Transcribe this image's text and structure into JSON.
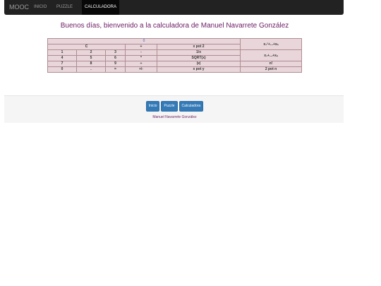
{
  "nav": {
    "brand": "MOOC",
    "links": [
      "INICIO",
      "PUZZLE",
      "CALCULADORA"
    ]
  },
  "greeting": "Buenos días, bienvenido a la calculadora de Manuel Navarrete González",
  "calculator": {
    "display": "0",
    "clear": "C",
    "keys": {
      "plus": "+",
      "minus": "-",
      "times": "*",
      "div": "÷",
      "sign": "+/-",
      "dot": ".",
      "equals": "=",
      "d0": "0",
      "d1": "1",
      "d2": "2",
      "d3": "3",
      "d4": "4",
      "d5": "5",
      "d6": "6",
      "d7": "7",
      "d8": "8",
      "d9": "9"
    },
    "funcs": {
      "xpot2": "x pot 2",
      "inv": "1/x",
      "sqrt": "SQRT(x)",
      "abs": "|x|",
      "xpoty": "x pot y",
      "factorial": "n!",
      "pot2n": "2 pot n",
      "sumsq": "x₁²+...+xₙ",
      "sum": "x₁+...+xₙ"
    }
  },
  "footer": {
    "buttons": [
      "Inicio",
      "Puzzle",
      "Calculadora"
    ],
    "credit": "Manuel Navarrete González"
  },
  "colors": {
    "accent": "#6a1b63",
    "cell": "#e8d6da",
    "button": "#337ab7",
    "navbar": "#222222"
  }
}
